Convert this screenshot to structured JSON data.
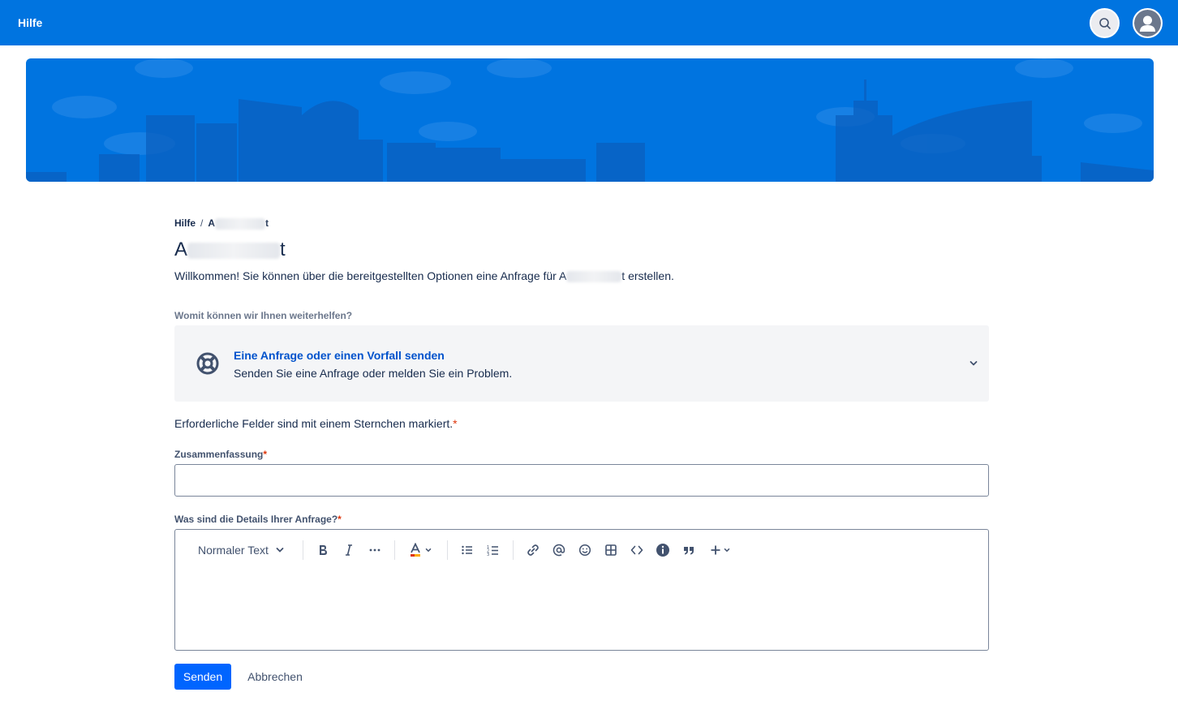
{
  "topbar": {
    "title": "Hilfe"
  },
  "icons": {
    "search": "search-icon",
    "avatar": "user-avatar-icon",
    "lifebuoy": "lifebuoy-icon",
    "chevron": "chevron-down-icon"
  },
  "breadcrumb": {
    "home": "Hilfe",
    "separator": "/",
    "portal_first": "A",
    "portal_last": "t"
  },
  "page": {
    "title_first": "A",
    "title_last": "t",
    "welcome_before": "Willkommen! Sie können über die bereitgestellten Optionen eine Anfrage für A",
    "welcome_after": "t erstellen."
  },
  "help_question": "Womit können wir Ihnen weiterhelfen?",
  "request_type": {
    "title": "Eine Anfrage oder einen Vorfall senden",
    "description": "Senden Sie eine Anfrage oder melden Sie ein Problem."
  },
  "form": {
    "required_note": "Erforderliche Felder sind mit einem Sternchen markiert.",
    "star": "*",
    "summary_label": "Zusammenfassung",
    "summary_value": "",
    "details_label": "Was sind die Details Ihrer Anfrage?",
    "editor": {
      "text_style": "Normaler Text"
    },
    "send_label": "Senden",
    "cancel_label": "Abbrechen"
  },
  "colors": {
    "brand": "#0074e0",
    "primary_button": "#0065ff",
    "link": "#0052cc",
    "required": "#de350b"
  }
}
